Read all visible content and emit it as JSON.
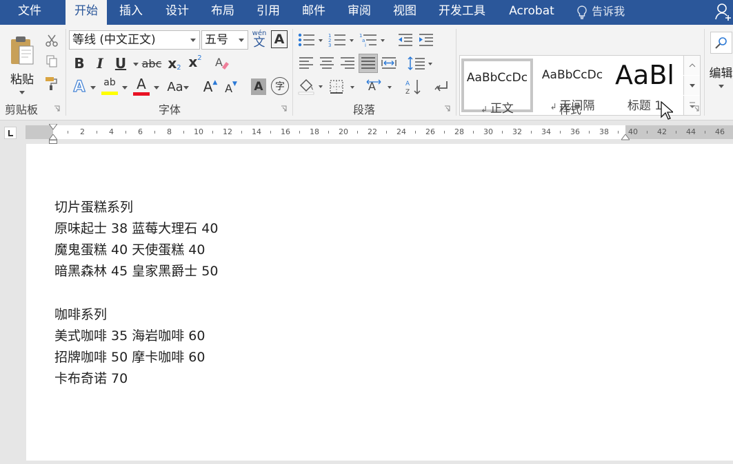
{
  "tabs": [
    {
      "label": "文件",
      "active": false
    },
    {
      "label": "开始",
      "active": true
    },
    {
      "label": "插入",
      "active": false
    },
    {
      "label": "设计",
      "active": false
    },
    {
      "label": "布局",
      "active": false
    },
    {
      "label": "引用",
      "active": false
    },
    {
      "label": "邮件",
      "active": false
    },
    {
      "label": "审阅",
      "active": false
    },
    {
      "label": "视图",
      "active": false
    },
    {
      "label": "开发工具",
      "active": false
    },
    {
      "label": "Acrobat",
      "active": false
    }
  ],
  "tell_me": "告诉我",
  "ribbon": {
    "clipboard": {
      "paste_label": "粘贴",
      "group_label": "剪贴板"
    },
    "font": {
      "font_name": "等线 (中文正文)",
      "font_size": "五号",
      "wen_label": "wén",
      "wen_char": "文",
      "bold": "B",
      "italic": "I",
      "underline": "U",
      "strike": "abc",
      "subscript": "x",
      "subscript_mark": "2",
      "superscript": "x",
      "superscript_mark": "2",
      "highlight_text": "ab",
      "font_color_text": "A",
      "change_case": "Aa",
      "grow": "A",
      "shrink": "A",
      "char_shading": "A",
      "enclose_char": "字",
      "group_label": "字体",
      "highlight_color": "#ffff00",
      "font_color": "#e81123"
    },
    "paragraph": {
      "group_label": "段落"
    },
    "styles": {
      "items": [
        {
          "sample": "AaBbCcDc",
          "name": "正文",
          "selected": true
        },
        {
          "sample": "AaBbCcDc",
          "name": "无间隔",
          "selected": false
        },
        {
          "sample": "AaBl",
          "name": "标题 1",
          "selected": false
        }
      ],
      "group_label": "样式"
    },
    "editing": {
      "label": "编辑"
    }
  },
  "ruler": {
    "numbers": [
      "2",
      "4",
      "6",
      "8",
      "10",
      "12",
      "14",
      "16",
      "18",
      "20",
      "22",
      "24",
      "26",
      "28",
      "30",
      "32",
      "34",
      "36",
      "38",
      "40",
      "42",
      "44",
      "46"
    ]
  },
  "document": {
    "lines": [
      "切片蛋糕系列",
      "原味起士  38 蓝莓大理石  40",
      "魔鬼蛋糕  40 天使蛋糕  40",
      "暗黑森林  45 皇家黑爵士  50",
      "",
      "咖啡系列",
      "美式咖啡  35 海岩咖啡 60",
      "招牌咖啡  50 摩卡咖啡  60",
      "卡布奇诺  70"
    ]
  },
  "colors": {
    "tabbar": "#2b579a",
    "ribbon": "#f3f3f3",
    "accent_blue": "#2b579a"
  }
}
